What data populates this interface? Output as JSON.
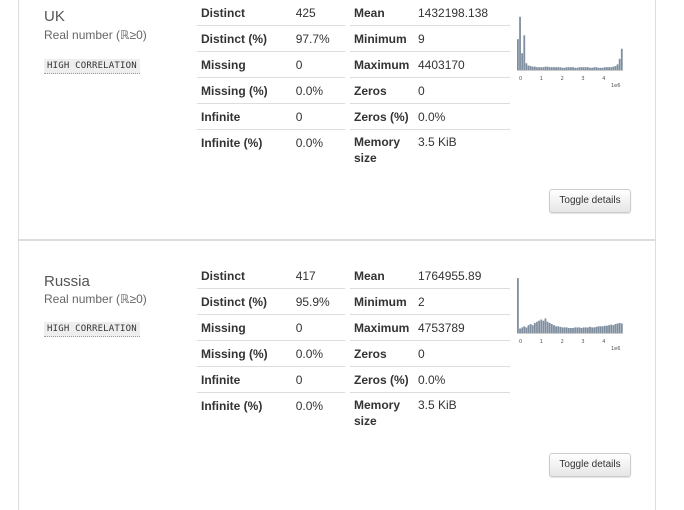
{
  "variables": [
    {
      "name": "UK",
      "type_label": "Real number (ℝ≥0)",
      "badge": "HIGH CORRELATION",
      "stats_left": [
        {
          "label": "Distinct",
          "value": "425"
        },
        {
          "label": "Distinct (%)",
          "value": "97.7%"
        },
        {
          "label": "Missing",
          "value": "0"
        },
        {
          "label": "Missing (%)",
          "value": "0.0%"
        },
        {
          "label": "Infinite",
          "value": "0"
        },
        {
          "label": "Infinite (%)",
          "value": "0.0%"
        }
      ],
      "stats_right": [
        {
          "label": "Mean",
          "value": "1432198.138"
        },
        {
          "label": "Minimum",
          "value": "9"
        },
        {
          "label": "Maximum",
          "value": "4403170"
        },
        {
          "label": "Zeros",
          "value": "0"
        },
        {
          "label": "Zeros (%)",
          "value": "0.0%"
        },
        {
          "label": "Memory size",
          "value": "3.5 KiB"
        }
      ],
      "histogram": {
        "bars": [
          0.55,
          0.95,
          0.3,
          0.62,
          0.12,
          0.08,
          0.07,
          0.06,
          0.06,
          0.05,
          0.05,
          0.05,
          0.05,
          0.06,
          0.06,
          0.05,
          0.05,
          0.05,
          0.05,
          0.05,
          0.05,
          0.04,
          0.04,
          0.05,
          0.05,
          0.05,
          0.05,
          0.04,
          0.04,
          0.05,
          0.05,
          0.05,
          0.05,
          0.05,
          0.04,
          0.04,
          0.05,
          0.05,
          0.04,
          0.04,
          0.04,
          0.05,
          0.05,
          0.05,
          0.05,
          0.06,
          0.07,
          0.1,
          0.2,
          0.38
        ],
        "ticks": [
          "0",
          "1",
          "2",
          "3",
          "4"
        ],
        "multiplier": "1e6"
      },
      "toggle_label": "Toggle details"
    },
    {
      "name": "Russia",
      "type_label": "Real number (ℝ≥0)",
      "badge": "HIGH CORRELATION",
      "stats_left": [
        {
          "label": "Distinct",
          "value": "417"
        },
        {
          "label": "Distinct (%)",
          "value": "95.9%"
        },
        {
          "label": "Missing",
          "value": "0"
        },
        {
          "label": "Missing (%)",
          "value": "0.0%"
        },
        {
          "label": "Infinite",
          "value": "0"
        },
        {
          "label": "Infinite (%)",
          "value": "0.0%"
        }
      ],
      "stats_right": [
        {
          "label": "Mean",
          "value": "1764955.89"
        },
        {
          "label": "Minimum",
          "value": "2"
        },
        {
          "label": "Maximum",
          "value": "4753789"
        },
        {
          "label": "Zeros",
          "value": "0"
        },
        {
          "label": "Zeros (%)",
          "value": "0.0%"
        },
        {
          "label": "Memory size",
          "value": "3.5 KiB"
        }
      ],
      "histogram": {
        "bars": [
          0.98,
          0.08,
          0.1,
          0.12,
          0.1,
          0.14,
          0.16,
          0.14,
          0.18,
          0.2,
          0.22,
          0.24,
          0.22,
          0.26,
          0.2,
          0.18,
          0.16,
          0.14,
          0.12,
          0.12,
          0.11,
          0.1,
          0.1,
          0.1,
          0.09,
          0.09,
          0.09,
          0.1,
          0.1,
          0.1,
          0.09,
          0.1,
          0.1,
          0.1,
          0.11,
          0.1,
          0.1,
          0.11,
          0.12,
          0.12,
          0.12,
          0.13,
          0.13,
          0.14,
          0.15,
          0.14,
          0.16,
          0.17,
          0.18,
          0.17
        ],
        "ticks": [
          "0",
          "1",
          "2",
          "3",
          "4"
        ],
        "multiplier": "1e6"
      },
      "toggle_label": "Toggle details"
    }
  ]
}
